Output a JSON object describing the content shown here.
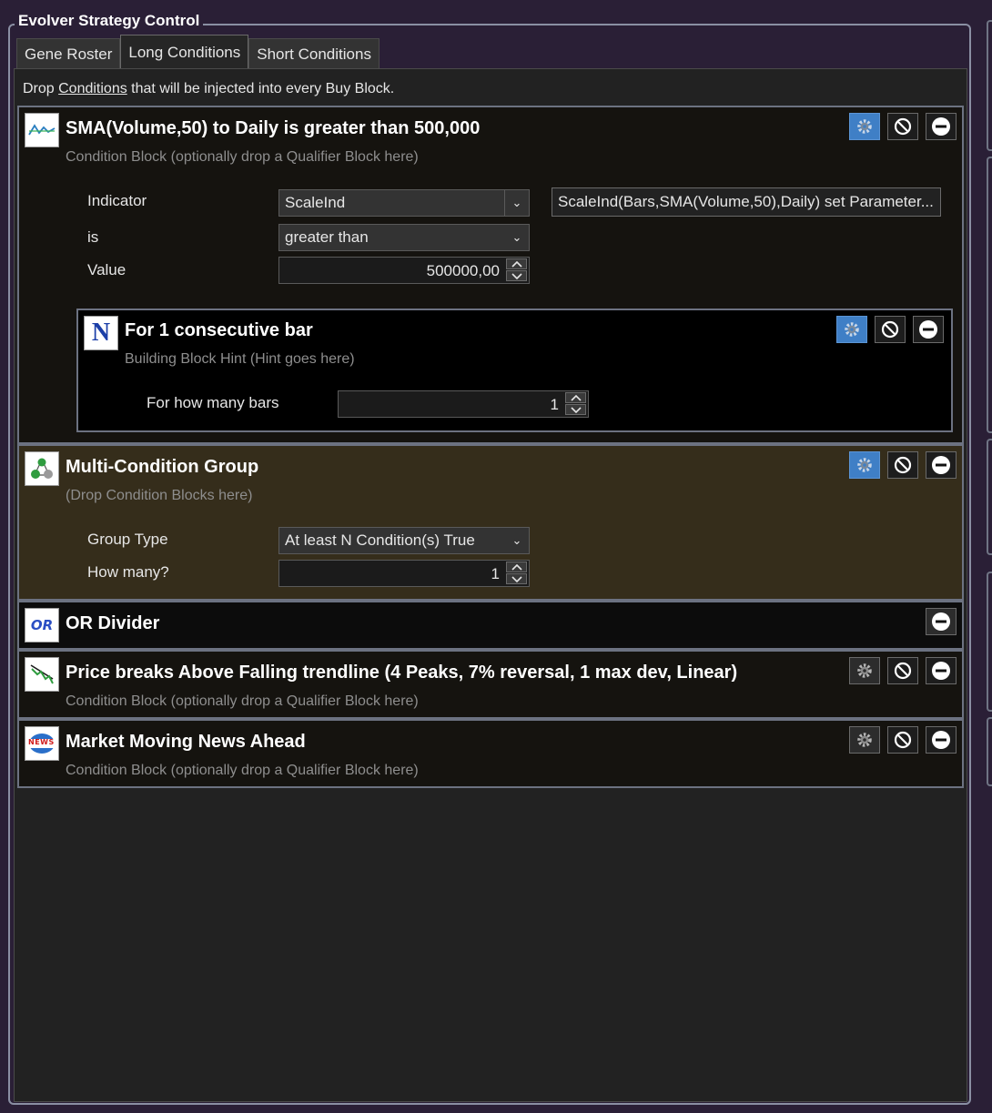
{
  "window": {
    "title": "Evolver Strategy Control"
  },
  "tabs": [
    {
      "label": "Gene Roster",
      "active": false
    },
    {
      "label": "Long Conditions",
      "active": true
    },
    {
      "label": "Short Conditions",
      "active": false
    }
  ],
  "hint": {
    "prefix": "Drop ",
    "link": "Conditions",
    "suffix": " that will be injected into every Buy Block."
  },
  "blocks": [
    {
      "title": "SMA(Volume,50) to Daily is greater than 500,000",
      "subtitle": "Condition Block (optionally drop a Qualifier Block here)",
      "icon": "sma-line-icon",
      "params": {
        "indicator_label": "Indicator",
        "indicator_value": "ScaleInd",
        "indicator_expr": "ScaleInd(Bars,SMA(Volume,50),Daily) set Parameter...",
        "is_label": "is",
        "is_value": "greater than",
        "value_label": "Value",
        "value_value": "500000,00"
      },
      "qualifier": {
        "title": "For 1 consecutive bar",
        "subtitle": "Building Block Hint (Hint goes here)",
        "icon": "n-letter-icon",
        "icon_text": "N",
        "bars_label": "For how many bars",
        "bars_value": "1"
      }
    },
    {
      "title": "Multi-Condition Group",
      "subtitle": "(Drop Condition Blocks here)",
      "icon": "group-circles-icon",
      "params": {
        "group_type_label": "Group Type",
        "group_type_value": "At least N Condition(s) True",
        "how_many_label": "How many?",
        "how_many_value": "1"
      }
    },
    {
      "title": "OR Divider",
      "icon": "or-icon",
      "icon_text": "OR"
    },
    {
      "title": "Price breaks Above Falling trendline (4 Peaks, 7% reversal, 1 max dev, Linear)",
      "subtitle": "Condition Block (optionally drop a Qualifier Block here)",
      "icon": "trendline-icon"
    },
    {
      "title": "Market Moving News Ahead",
      "subtitle": "Condition Block (optionally drop a Qualifier Block here)",
      "icon": "news-icon",
      "icon_text": "NEWS"
    }
  ],
  "colors": {
    "background": "#2a1f36",
    "panel": "#222222",
    "block_dark": "#15130f",
    "block_olive": "#352d1b",
    "settings_active": "#3f7fc6"
  }
}
